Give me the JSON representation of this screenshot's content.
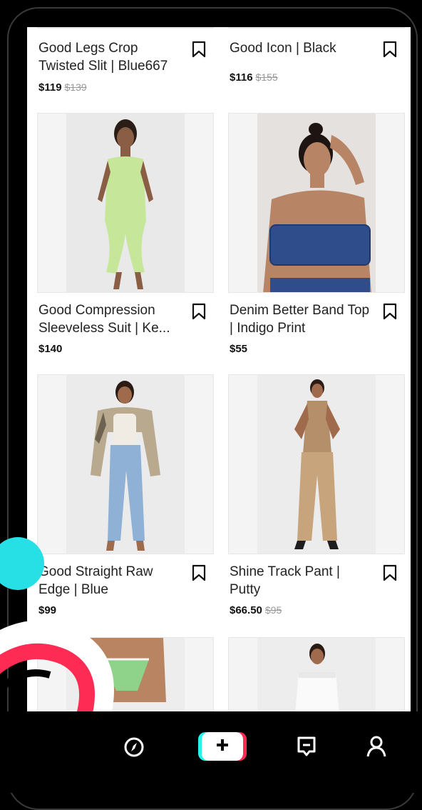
{
  "products": [
    {
      "name": "Good Legs Crop Twisted Slit | Blue667",
      "price": "$119",
      "old_price": "$139"
    },
    {
      "name": "Good Icon | Black",
      "price": "$116",
      "old_price": "$155"
    },
    {
      "name": "Good Compression Sleeveless Suit | Ke...",
      "price": "$140",
      "old_price": ""
    },
    {
      "name": "Denim Better Band Top | Indigo Print",
      "price": "$55",
      "old_price": ""
    },
    {
      "name": "Good Straight Raw Edge | Blue",
      "price": "$99",
      "old_price": ""
    },
    {
      "name": "Shine Track Pant | Putty",
      "price": "$66.50",
      "old_price": "$95"
    }
  ],
  "nav": {
    "items": [
      {
        "icon": "compass-icon"
      },
      {
        "icon": "plus-icon"
      },
      {
        "icon": "inbox-icon"
      },
      {
        "icon": "profile-icon"
      }
    ]
  },
  "colors": {
    "accent_cyan": "#25f4ee",
    "accent_red": "#fe2c55",
    "background": "#000000",
    "card_background": "#ffffff"
  }
}
